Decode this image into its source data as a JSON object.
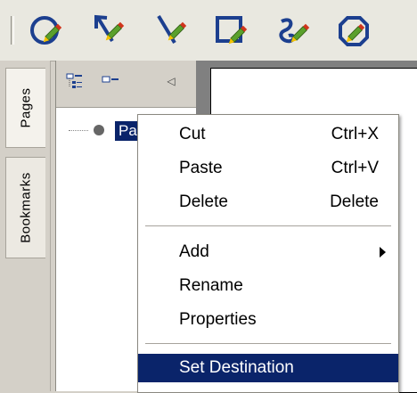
{
  "toolbar": {
    "tools": [
      {
        "icon": "circle-pencil-icon"
      },
      {
        "icon": "arrow-pencil-icon"
      },
      {
        "icon": "line-pencil-icon"
      },
      {
        "icon": "rectangle-pencil-icon"
      },
      {
        "icon": "freehand-pencil-icon"
      },
      {
        "icon": "polygon-pencil-icon"
      }
    ]
  },
  "side_tabs": {
    "pages": "Pages",
    "bookmarks": "Bookmarks"
  },
  "panel": {
    "tree_item_label": "Pa"
  },
  "context_menu": {
    "items": [
      {
        "label": "Cut",
        "shortcut": "Ctrl+X"
      },
      {
        "label": "Paste",
        "shortcut": "Ctrl+V"
      },
      {
        "label": "Delete",
        "shortcut": "Delete"
      },
      {
        "label": "Add",
        "shortcut": ""
      },
      {
        "label": "Rename",
        "shortcut": ""
      },
      {
        "label": "Properties",
        "shortcut": ""
      },
      {
        "label": "Set Destination",
        "shortcut": ""
      }
    ]
  },
  "colors": {
    "highlight": "#0a246a",
    "icon_blue": "#1c3f8f",
    "pencil_green": "#5aa02c",
    "pencil_yellow": "#f2c200",
    "pencil_red": "#d0341c"
  }
}
